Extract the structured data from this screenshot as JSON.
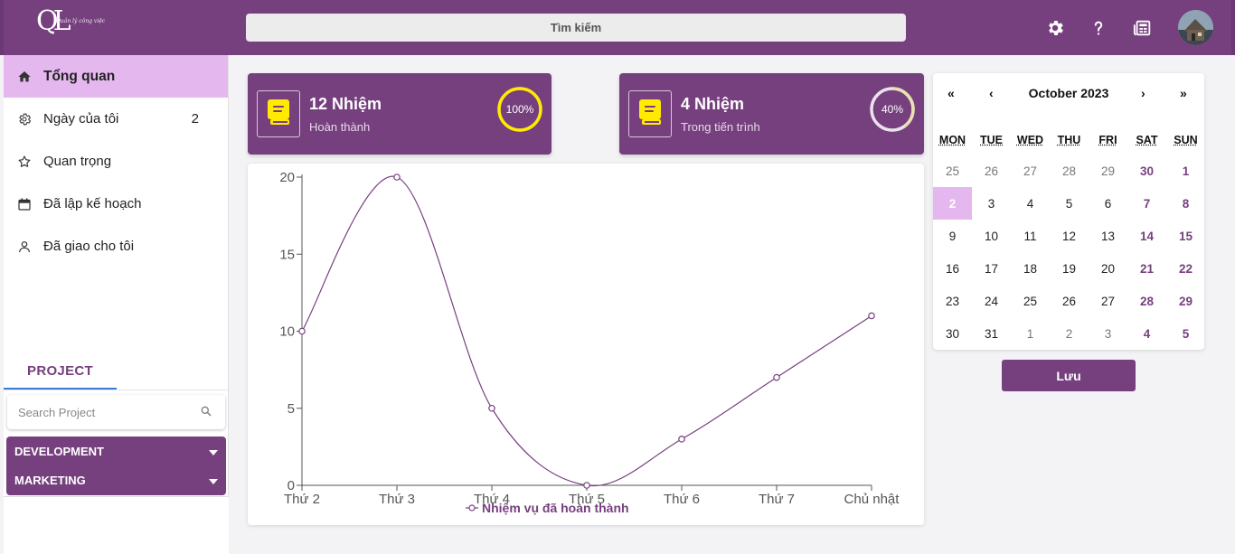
{
  "header": {
    "logo_text": "QL",
    "logo_script": "Quản lý công việc",
    "search_label": "Tìm kiếm"
  },
  "icons": {
    "settings": "gear-icon",
    "help": "question-icon",
    "news": "newspaper-icon"
  },
  "sidebar": {
    "items": [
      {
        "label": "Tổng quan",
        "icon": "home-icon",
        "count": ""
      },
      {
        "label": "Ngày của tôi",
        "icon": "gear-icon",
        "count": "2"
      },
      {
        "label": "Quan trọng",
        "icon": "star-icon",
        "count": ""
      },
      {
        "label": "Đã lập kế hoạch",
        "icon": "calendar-icon",
        "count": ""
      },
      {
        "label": "Đã giao cho tôi",
        "icon": "person-icon",
        "count": ""
      }
    ],
    "project_tab": "PROJECT",
    "project_search_placeholder": "Search Project",
    "projects": [
      {
        "label": "DEVELOPMENT"
      },
      {
        "label": "MARKETING"
      }
    ]
  },
  "cards": [
    {
      "title": "12 Nhiệm",
      "subtitle": "Hoàn thành",
      "percent_label": "100%",
      "percent": 100,
      "ring_color": "#ffea00"
    },
    {
      "title": "4 Nhiệm",
      "subtitle": "Trong tiến trình",
      "percent_label": "40%",
      "percent": 40,
      "ring_color": "#e8e0b0"
    }
  ],
  "chart_data": {
    "type": "line",
    "categories": [
      "Thứ 2",
      "Thứ 3",
      "Thứ 4",
      "Thứ 5",
      "Thứ 6",
      "Thứ 7",
      "Chủ nhật"
    ],
    "series": [
      {
        "name": "Nhiệm vụ đã hoàn thành",
        "values": [
          10,
          20,
          5,
          0,
          3,
          7,
          11
        ]
      }
    ],
    "yticks": [
      "0",
      "5",
      "10",
      "15",
      "20"
    ],
    "ylim": [
      0,
      20
    ],
    "color": "#76407e",
    "legend": "bottom"
  },
  "calendar": {
    "title": "October 2023",
    "nav": {
      "prev_year": "«",
      "prev_month": "‹",
      "next_month": "›",
      "next_year": "»"
    },
    "weekdays": [
      "MON",
      "TUE",
      "WED",
      "THU",
      "FRI",
      "SAT",
      "SUN"
    ],
    "weeks": [
      [
        "25",
        "26",
        "27",
        "28",
        "29",
        "30",
        "1"
      ],
      [
        "2",
        "3",
        "4",
        "5",
        "6",
        "7",
        "8"
      ],
      [
        "9",
        "10",
        "11",
        "12",
        "13",
        "14",
        "15"
      ],
      [
        "16",
        "17",
        "18",
        "19",
        "20",
        "21",
        "22"
      ],
      [
        "23",
        "24",
        "25",
        "26",
        "27",
        "28",
        "29"
      ],
      [
        "30",
        "31",
        "1",
        "2",
        "3",
        "4",
        "5"
      ]
    ],
    "selected": "2",
    "save_label": "Lưu"
  }
}
